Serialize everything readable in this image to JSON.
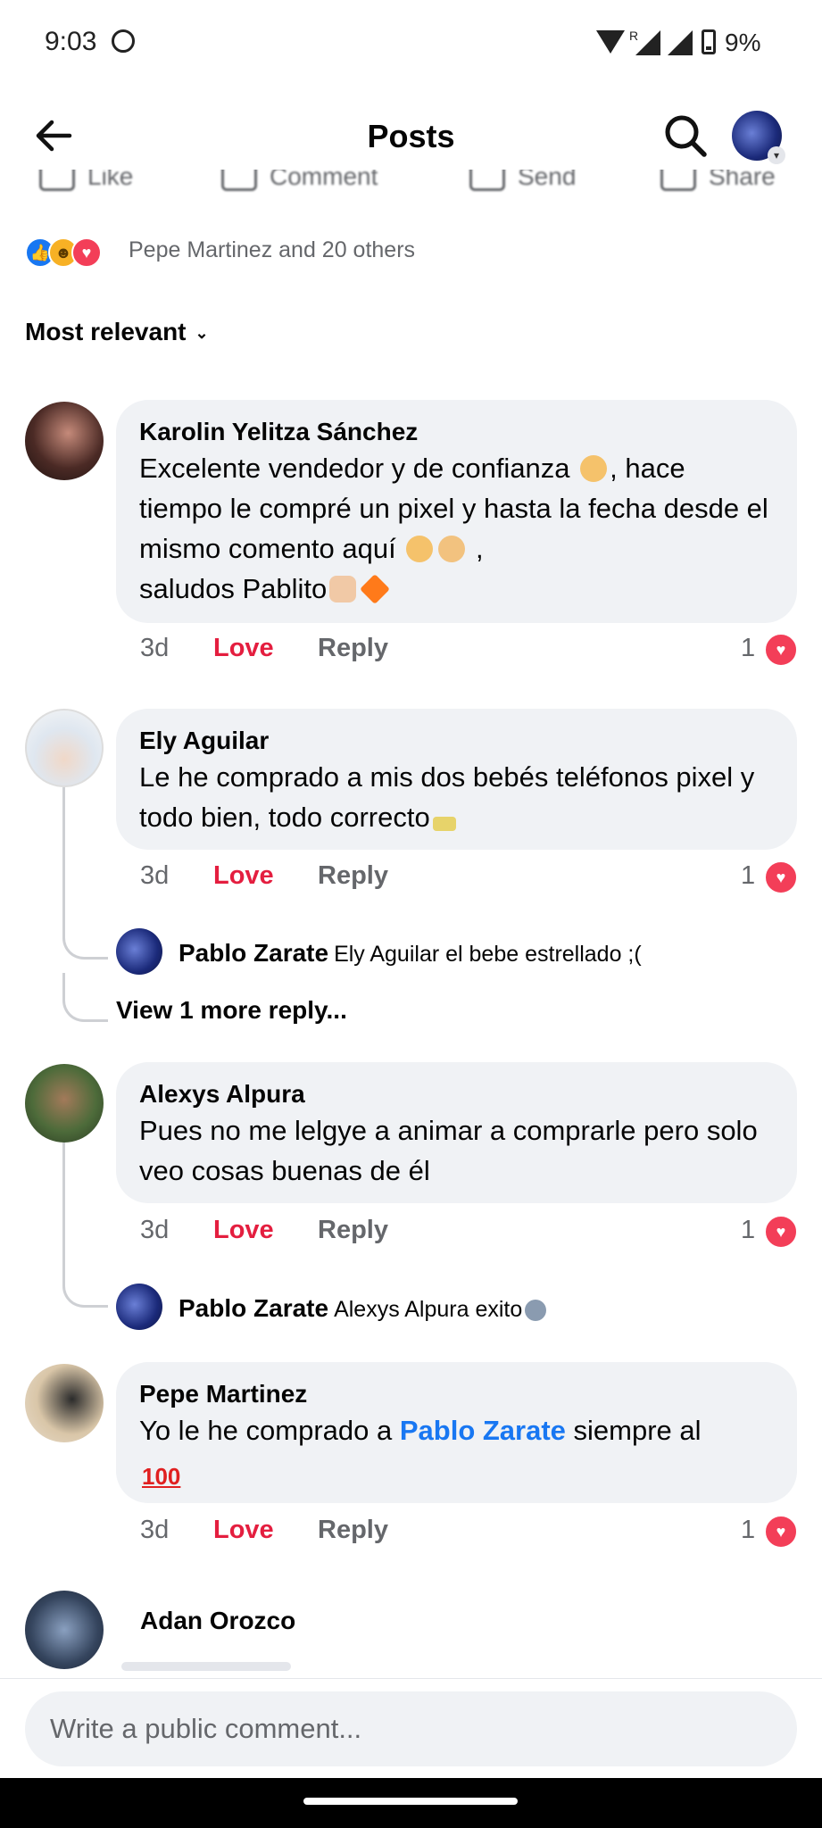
{
  "status_bar": {
    "time": "9:03",
    "roaming": "R",
    "battery": "9%"
  },
  "header": {
    "title": "Posts"
  },
  "actions": {
    "like": "Like",
    "comment": "Comment",
    "send": "Send",
    "share": "Share"
  },
  "reactions_summary": "Pepe Martinez and 20 others",
  "sort": {
    "label": "Most relevant"
  },
  "comments": [
    {
      "name": "Karolin Yelitza Sánchez",
      "text_1": "Excelente vendedor y de confianza",
      "text_2": ", hace tiempo le compré un pixel y hasta la fecha desde el mismo comento aquí",
      "text_3": ",",
      "text_4": "saludos Pablito",
      "time": "3d",
      "love": "Love",
      "reply": "Reply",
      "count": "1"
    },
    {
      "name": "Ely Aguilar",
      "text_1": "Le he comprado a mis dos bebés teléfonos pixel y todo bien, todo correcto",
      "time": "3d",
      "love": "Love",
      "reply": "Reply",
      "count": "1",
      "sub_reply": {
        "name": "Pablo Zarate",
        "text": "Ely Aguilar el bebe estrellado ;("
      },
      "view_more": "View 1 more reply..."
    },
    {
      "name": "Alexys Alpura",
      "text_1": "Pues no me lelgye a animar a comprarle pero solo veo cosas buenas de él",
      "time": "3d",
      "love": "Love",
      "reply": "Reply",
      "count": "1",
      "sub_reply": {
        "name": "Pablo Zarate",
        "text": "Alexys Alpura exito"
      }
    },
    {
      "name": "Pepe Martinez",
      "text_1": "Yo le he comprado a",
      "mention": "Pablo Zarate",
      "text_2": "siempre al",
      "time": "3d",
      "love": "Love",
      "reply": "Reply",
      "count": "1"
    },
    {
      "name": "Adan Orozco"
    }
  ],
  "composer": {
    "placeholder": "Write a public comment..."
  },
  "colors": {
    "love_red": "#e41e3f",
    "link_blue": "#1877f2",
    "bubble_bg": "#f0f2f5"
  }
}
